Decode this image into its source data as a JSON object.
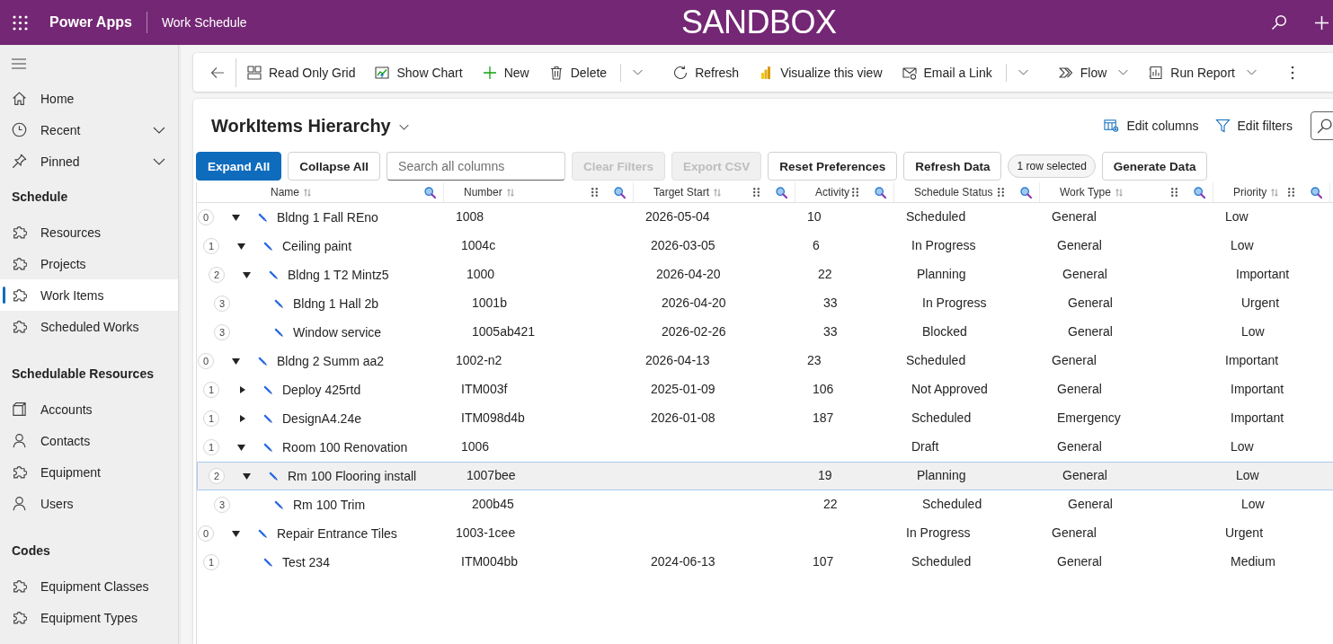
{
  "top_bar": {
    "app_name": "Power Apps",
    "title": "Work Schedule",
    "environment": "SANDBOX"
  },
  "sidebar": {
    "top_items": [
      {
        "label": "Home",
        "kind": "home",
        "selected": false
      },
      {
        "label": "Recent",
        "kind": "recent",
        "selected": false,
        "expanded": false
      },
      {
        "label": "Pinned",
        "kind": "pinned",
        "selected": false,
        "expanded": false
      }
    ],
    "groups": [
      {
        "title": "Schedule",
        "items": [
          {
            "label": "Resources",
            "kind": "entity",
            "selected": false
          },
          {
            "label": "Projects",
            "kind": "entity",
            "selected": false
          },
          {
            "label": "Work Items",
            "kind": "entity",
            "selected": true
          },
          {
            "label": "Scheduled Works",
            "kind": "entity",
            "selected": false
          }
        ]
      },
      {
        "title": "Schedulable Resources",
        "items": [
          {
            "label": "Accounts",
            "kind": "account",
            "selected": false
          },
          {
            "label": "Contacts",
            "kind": "person",
            "selected": false
          },
          {
            "label": "Equipment",
            "kind": "entity",
            "selected": false
          },
          {
            "label": "Users",
            "kind": "person",
            "selected": false
          }
        ]
      },
      {
        "title": "Codes",
        "items": [
          {
            "label": "Equipment Classes",
            "kind": "entity",
            "selected": false
          },
          {
            "label": "Equipment Types",
            "kind": "entity",
            "selected": false
          }
        ]
      }
    ]
  },
  "command_bar": [
    {
      "label": "Read Only Grid",
      "kind": "grid"
    },
    {
      "label": "Show Chart",
      "kind": "chart"
    },
    {
      "label": "New",
      "kind": "new"
    },
    {
      "label": "Delete",
      "kind": "delete"
    },
    {
      "label": "Refresh",
      "kind": "refresh"
    },
    {
      "label": "Visualize this view",
      "kind": "visualize"
    },
    {
      "label": "Email a Link",
      "kind": "email"
    },
    {
      "label": "Flow",
      "kind": "flow"
    },
    {
      "label": "Run Report",
      "kind": "report"
    }
  ],
  "view": {
    "title": "WorkItems Hierarchy",
    "actions": [
      {
        "label": "Edit columns",
        "kind": "columns"
      },
      {
        "label": "Edit filters",
        "kind": "filter"
      }
    ]
  },
  "grid_toolbar": [
    {
      "kind": "button",
      "label": "Expand All",
      "primary": true,
      "disabled": false
    },
    {
      "kind": "button",
      "label": "Collapse All",
      "primary": false,
      "disabled": false
    },
    {
      "kind": "search",
      "placeholder": "Search all columns"
    },
    {
      "kind": "button",
      "label": "Clear Filters",
      "primary": false,
      "disabled": true
    },
    {
      "kind": "button",
      "label": "Export CSV",
      "primary": false,
      "disabled": true
    },
    {
      "kind": "button",
      "label": "Reset Preferences",
      "primary": false,
      "disabled": false
    },
    {
      "kind": "button",
      "label": "Refresh Data",
      "primary": false,
      "disabled": false
    },
    {
      "kind": "status",
      "label": "1 row selected"
    },
    {
      "kind": "button",
      "label": "Generate Data",
      "primary": false,
      "disabled": false
    }
  ],
  "table": {
    "columns": [
      {
        "label": "Name",
        "sortable": true,
        "movable": false
      },
      {
        "label": "Number",
        "sortable": true,
        "movable": true
      },
      {
        "label": "Target Start",
        "sortable": true,
        "movable": true
      },
      {
        "label": "Activity",
        "sortable": false,
        "movable": true
      },
      {
        "label": "Schedule Status",
        "sortable": false,
        "movable": true
      },
      {
        "label": "Work Type",
        "sortable": true,
        "movable": true
      },
      {
        "label": "Priority",
        "sortable": true,
        "movable": true
      }
    ],
    "rows": [
      {
        "badge": "0",
        "name": "Bldng 1 Fall REno",
        "number": "1008",
        "target_start": "2026-05-04",
        "activity": "10",
        "schedule_status": "Scheduled",
        "work_type": "General",
        "priority": "Low",
        "expanded": true,
        "selected": false,
        "children": [
          {
            "badge": "1",
            "name": "Ceiling paint",
            "number": "1004c",
            "target_start": "2026-03-05",
            "activity": "6",
            "schedule_status": "In Progress",
            "work_type": "General",
            "priority": "Low",
            "expanded": true,
            "selected": false,
            "children": [
              {
                "badge": "2",
                "name": "Bldng 1 T2 Mintz5",
                "number": "1000",
                "target_start": "2026-04-20",
                "activity": "22",
                "schedule_status": "Planning",
                "work_type": "General",
                "priority": "Important",
                "expanded": true,
                "selected": false,
                "children": [
                  {
                    "badge": "3",
                    "name": "Bldng 1 Hall 2b",
                    "number": "1001b",
                    "target_start": "2026-04-20",
                    "activity": "33",
                    "schedule_status": "In Progress",
                    "work_type": "General",
                    "priority": "Urgent",
                    "selected": false
                  },
                  {
                    "badge": "3",
                    "name": "Window service",
                    "number": "1005ab421",
                    "target_start": "2026-02-26",
                    "activity": "33",
                    "schedule_status": "Blocked",
                    "work_type": "General",
                    "priority": "Low",
                    "selected": false
                  }
                ]
              }
            ]
          }
        ]
      },
      {
        "badge": "0",
        "name": "Bldng 2 Summ aa2",
        "number": "1002-n2",
        "target_start": "2026-04-13",
        "activity": "23",
        "schedule_status": "Scheduled",
        "work_type": "General",
        "priority": "Important",
        "expanded": true,
        "selected": false,
        "children": [
          {
            "badge": "1",
            "name": "Deploy 425rtd",
            "number": "ITM003f",
            "target_start": "2025-01-09",
            "activity": "106",
            "schedule_status": "Not Approved",
            "work_type": "General",
            "priority": "Important",
            "expanded": false,
            "selected": false
          },
          {
            "badge": "1",
            "name": "DesignA4.24e",
            "number": "ITM098d4b",
            "target_start": "2026-01-08",
            "activity": "187",
            "schedule_status": "Scheduled",
            "work_type": "Emergency",
            "priority": "Important",
            "expanded": false,
            "selected": false
          },
          {
            "badge": "1",
            "name": "Room 100 Renovation",
            "number": "1006",
            "schedule_status": "Draft",
            "work_type": "General",
            "priority": "Low",
            "expanded": true,
            "selected": false,
            "children": [
              {
                "badge": "2",
                "name": "Rm 100 Flooring install",
                "number": "1007bee",
                "activity": "19",
                "schedule_status": "Planning",
                "work_type": "General",
                "priority": "Low",
                "expanded": true,
                "selected": true,
                "children": [
                  {
                    "badge": "3",
                    "name": "Rm 100 Trim",
                    "number": "200b45",
                    "activity": "22",
                    "schedule_status": "Scheduled",
                    "work_type": "General",
                    "priority": "Low",
                    "selected": false
                  }
                ]
              }
            ]
          }
        ]
      },
      {
        "badge": "0",
        "name": "Repair Entrance Tiles",
        "number": "1003-1cee",
        "schedule_status": "In Progress",
        "work_type": "General",
        "priority": "Urgent",
        "expanded": true,
        "selected": false,
        "children": [
          {
            "badge": "1",
            "name": "Test 234",
            "number": "ITM004bb",
            "target_start": "2024-06-13",
            "activity": "107",
            "schedule_status": "Scheduled",
            "work_type": "General",
            "priority": "Medium",
            "selected": false
          }
        ]
      }
    ]
  }
}
